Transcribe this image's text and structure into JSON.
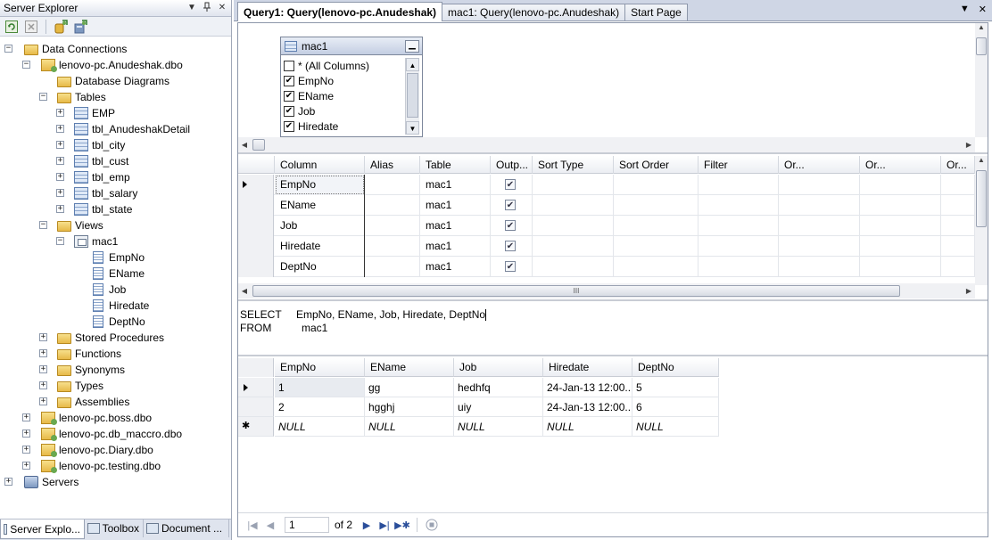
{
  "server_explorer": {
    "title": "Server Explorer",
    "pin_glyph": "ᴾ",
    "close_glyph": "✕",
    "dropdown_glyph": "▼",
    "tree": [
      {
        "label": "Data Connections",
        "depth": 0,
        "icon": "folder",
        "expanded": true
      },
      {
        "label": "lenovo-pc.Anudeshak.dbo",
        "depth": 1,
        "icon": "db",
        "expanded": true
      },
      {
        "label": "Database Diagrams",
        "depth": 2,
        "icon": "folder",
        "expandable": false
      },
      {
        "label": "Tables",
        "depth": 2,
        "icon": "folder",
        "expanded": true
      },
      {
        "label": "EMP",
        "depth": 3,
        "icon": "table",
        "expanded": false
      },
      {
        "label": "tbl_AnudeshakDetail",
        "depth": 3,
        "icon": "table",
        "expanded": false
      },
      {
        "label": "tbl_city",
        "depth": 3,
        "icon": "table",
        "expanded": false
      },
      {
        "label": "tbl_cust",
        "depth": 3,
        "icon": "table",
        "expanded": false
      },
      {
        "label": "tbl_emp",
        "depth": 3,
        "icon": "table",
        "expanded": false
      },
      {
        "label": "tbl_salary",
        "depth": 3,
        "icon": "table",
        "expanded": false
      },
      {
        "label": "tbl_state",
        "depth": 3,
        "icon": "table",
        "expanded": false
      },
      {
        "label": "Views",
        "depth": 2,
        "icon": "folder",
        "expanded": true
      },
      {
        "label": "mac1",
        "depth": 3,
        "icon": "view",
        "expanded": true
      },
      {
        "label": "EmpNo",
        "depth": 4,
        "icon": "col",
        "expandable": false
      },
      {
        "label": "EName",
        "depth": 4,
        "icon": "col",
        "expandable": false
      },
      {
        "label": "Job",
        "depth": 4,
        "icon": "col",
        "expandable": false
      },
      {
        "label": "Hiredate",
        "depth": 4,
        "icon": "col",
        "expandable": false
      },
      {
        "label": "DeptNo",
        "depth": 4,
        "icon": "col",
        "expandable": false
      },
      {
        "label": "Stored Procedures",
        "depth": 2,
        "icon": "folder",
        "expanded": false
      },
      {
        "label": "Functions",
        "depth": 2,
        "icon": "folder",
        "expanded": false
      },
      {
        "label": "Synonyms",
        "depth": 2,
        "icon": "folder",
        "expanded": false
      },
      {
        "label": "Types",
        "depth": 2,
        "icon": "folder",
        "expanded": false
      },
      {
        "label": "Assemblies",
        "depth": 2,
        "icon": "folder",
        "expanded": false
      },
      {
        "label": "lenovo-pc.boss.dbo",
        "depth": 1,
        "icon": "db",
        "expanded": false
      },
      {
        "label": "lenovo-pc.db_maccro.dbo",
        "depth": 1,
        "icon": "db",
        "expanded": false
      },
      {
        "label": "lenovo-pc.Diary.dbo",
        "depth": 1,
        "icon": "db",
        "expanded": false
      },
      {
        "label": "lenovo-pc.testing.dbo",
        "depth": 1,
        "icon": "db",
        "expanded": false
      },
      {
        "label": "Servers",
        "depth": 0,
        "icon": "server",
        "expanded": false
      }
    ],
    "bottom_tabs": [
      {
        "label": "Server Explo...",
        "active": true
      },
      {
        "label": "Toolbox",
        "active": false
      },
      {
        "label": "Document ...",
        "active": false
      }
    ]
  },
  "doc_tabs": [
    {
      "label": "Query1: Query(lenovo-pc.Anudeshak)",
      "active": true
    },
    {
      "label": "mac1: Query(lenovo-pc.Anudeshak)",
      "active": false
    },
    {
      "label": "Start Page",
      "active": false
    }
  ],
  "doc_tab_dropdown": "▼",
  "doc_tab_close": "✕",
  "diagram": {
    "table_name": "mac1",
    "minimize_glyph": "▁",
    "columns": [
      {
        "label": "* (All Columns)",
        "checked": false
      },
      {
        "label": "EmpNo",
        "checked": true
      },
      {
        "label": "EName",
        "checked": true
      },
      {
        "label": "Job",
        "checked": true
      },
      {
        "label": "Hiredate",
        "checked": true
      }
    ]
  },
  "criteria": {
    "headers": [
      "Column",
      "Alias",
      "Table",
      "Outp...",
      "Sort Type",
      "Sort Order",
      "Filter",
      "Or...",
      "Or...",
      "Or..."
    ],
    "rows": [
      {
        "column": "EmpNo",
        "alias": "",
        "table": "mac1",
        "output": true,
        "current": true
      },
      {
        "column": "EName",
        "alias": "",
        "table": "mac1",
        "output": true,
        "current": false
      },
      {
        "column": "Job",
        "alias": "",
        "table": "mac1",
        "output": true,
        "current": false
      },
      {
        "column": "Hiredate",
        "alias": "",
        "table": "mac1",
        "output": true,
        "current": false
      },
      {
        "column": "DeptNo",
        "alias": "",
        "table": "mac1",
        "output": true,
        "current": false
      }
    ]
  },
  "sql": {
    "select_kw": "SELECT",
    "select_list": "EmpNo, EName, Job, Hiredate, DeptNo",
    "from_kw": "FROM",
    "from_table": "mac1"
  },
  "results": {
    "headers": [
      "EmpNo",
      "EName",
      "Job",
      "Hiredate",
      "DeptNo"
    ],
    "rows": [
      {
        "cells": [
          "1",
          "gg",
          "hedhfq",
          "24-Jan-13 12:00...",
          "5"
        ],
        "marker": "current"
      },
      {
        "cells": [
          "2",
          "hgghj",
          "uiy",
          "24-Jan-13 12:00...",
          "6"
        ],
        "marker": ""
      },
      {
        "cells": [
          "NULL",
          "NULL",
          "NULL",
          "NULL",
          "NULL"
        ],
        "marker": "new"
      }
    ]
  },
  "navigator": {
    "current_record": "1",
    "of_text": "of 2"
  }
}
